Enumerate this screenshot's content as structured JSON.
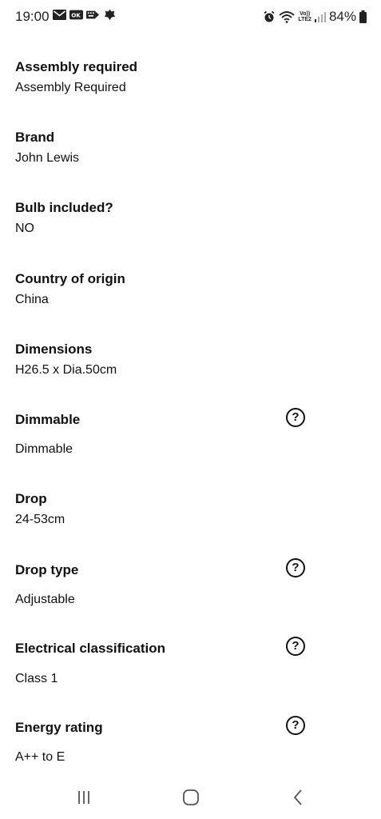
{
  "status_bar": {
    "time": "19:00",
    "battery": "84%",
    "network_top": "Vo))",
    "network_bottom": "LTE2",
    "left_icons": [
      "mail-icon",
      "app-icon",
      "keyboard-icon",
      "bank-icon"
    ],
    "right_icons": [
      "alarm-icon",
      "wifi-icon",
      "signal-icon",
      "battery-icon"
    ]
  },
  "specs": [
    {
      "label": "Assembly required",
      "value": "Assembly Required",
      "help": false
    },
    {
      "label": "Brand",
      "value": "John Lewis",
      "help": false
    },
    {
      "label": "Bulb included?",
      "value": "NO",
      "help": false
    },
    {
      "label": "Country of origin",
      "value": "China",
      "help": false
    },
    {
      "label": "Dimensions",
      "value": "H26.5 x Dia.50cm",
      "help": false
    },
    {
      "label": "Dimmable",
      "value": "Dimmable",
      "help": true
    },
    {
      "label": "Drop",
      "value": "24-53cm",
      "help": false
    },
    {
      "label": "Drop type",
      "value": "Adjustable",
      "help": true
    },
    {
      "label": "Electrical classification",
      "value": "Class 1",
      "help": true
    },
    {
      "label": "Energy rating",
      "value": "A++ to E",
      "help": true
    }
  ],
  "help_glyph": "?",
  "nav_bar": {
    "icons": [
      "recent-apps-icon",
      "home-icon",
      "back-icon"
    ]
  }
}
